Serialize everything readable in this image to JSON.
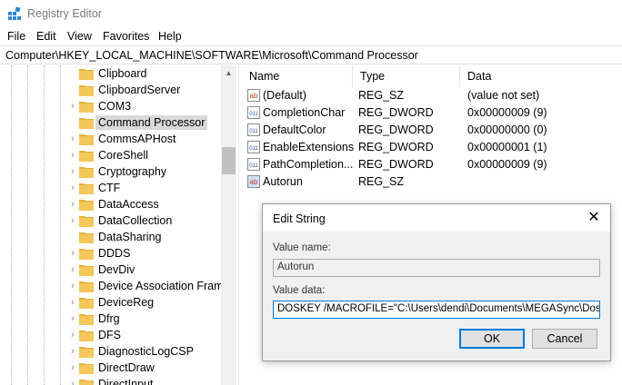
{
  "window": {
    "title": "Registry Editor"
  },
  "menu": {
    "items": [
      "File",
      "Edit",
      "View",
      "Favorites",
      "Help"
    ]
  },
  "address": {
    "path": "Computer\\HKEY_LOCAL_MACHINE\\SOFTWARE\\Microsoft\\Command Processor"
  },
  "tree": {
    "items": [
      {
        "label": "Clipboard",
        "expandable": false
      },
      {
        "label": "ClipboardServer",
        "expandable": false
      },
      {
        "label": "COM3",
        "expandable": true
      },
      {
        "label": "Command Processor",
        "expandable": false,
        "selected": true
      },
      {
        "label": "CommsAPHost",
        "expandable": true
      },
      {
        "label": "CoreShell",
        "expandable": true
      },
      {
        "label": "Cryptography",
        "expandable": true
      },
      {
        "label": "CTF",
        "expandable": true
      },
      {
        "label": "DataAccess",
        "expandable": true
      },
      {
        "label": "DataCollection",
        "expandable": true
      },
      {
        "label": "DataSharing",
        "expandable": false
      },
      {
        "label": "DDDS",
        "expandable": true
      },
      {
        "label": "DevDiv",
        "expandable": true
      },
      {
        "label": "Device Association Frame",
        "expandable": true
      },
      {
        "label": "DeviceReg",
        "expandable": true
      },
      {
        "label": "Dfrg",
        "expandable": true
      },
      {
        "label": "DFS",
        "expandable": true
      },
      {
        "label": "DiagnosticLogCSP",
        "expandable": true
      },
      {
        "label": "DirectDraw",
        "expandable": true
      },
      {
        "label": "DirectInput",
        "expandable": true
      }
    ]
  },
  "list": {
    "columns": {
      "name": "Name",
      "type": "Type",
      "data": "Data"
    },
    "rows": [
      {
        "name": "(Default)",
        "type": "REG_SZ",
        "data": "(value not set)",
        "icon": "string-value-icon"
      },
      {
        "name": "CompletionChar",
        "type": "REG_DWORD",
        "data": "0x00000009 (9)",
        "icon": "binary-value-icon"
      },
      {
        "name": "DefaultColor",
        "type": "REG_DWORD",
        "data": "0x00000000 (0)",
        "icon": "binary-value-icon"
      },
      {
        "name": "EnableExtensions",
        "type": "REG_DWORD",
        "data": "0x00000001 (1)",
        "icon": "binary-value-icon"
      },
      {
        "name": "PathCompletion...",
        "type": "REG_DWORD",
        "data": "0x00000009 (9)",
        "icon": "binary-value-icon"
      },
      {
        "name": "Autorun",
        "type": "REG_SZ",
        "data": "",
        "icon": "string-value-icon",
        "selected": true
      }
    ]
  },
  "dialog": {
    "title": "Edit String",
    "close_glyph": "✕",
    "value_name_label": "Value name:",
    "value_name": "Autorun",
    "value_data_label": "Value data:",
    "value_data": "DOSKEY /MACROFILE=\"C:\\Users\\dendi\\Documents\\MEGASync\\Doskey",
    "ok_label": "OK",
    "cancel_label": "Cancel"
  },
  "colors": {
    "accent": "#0078d7",
    "folder": "#f3c75a",
    "selection": "#d9d9d9"
  }
}
